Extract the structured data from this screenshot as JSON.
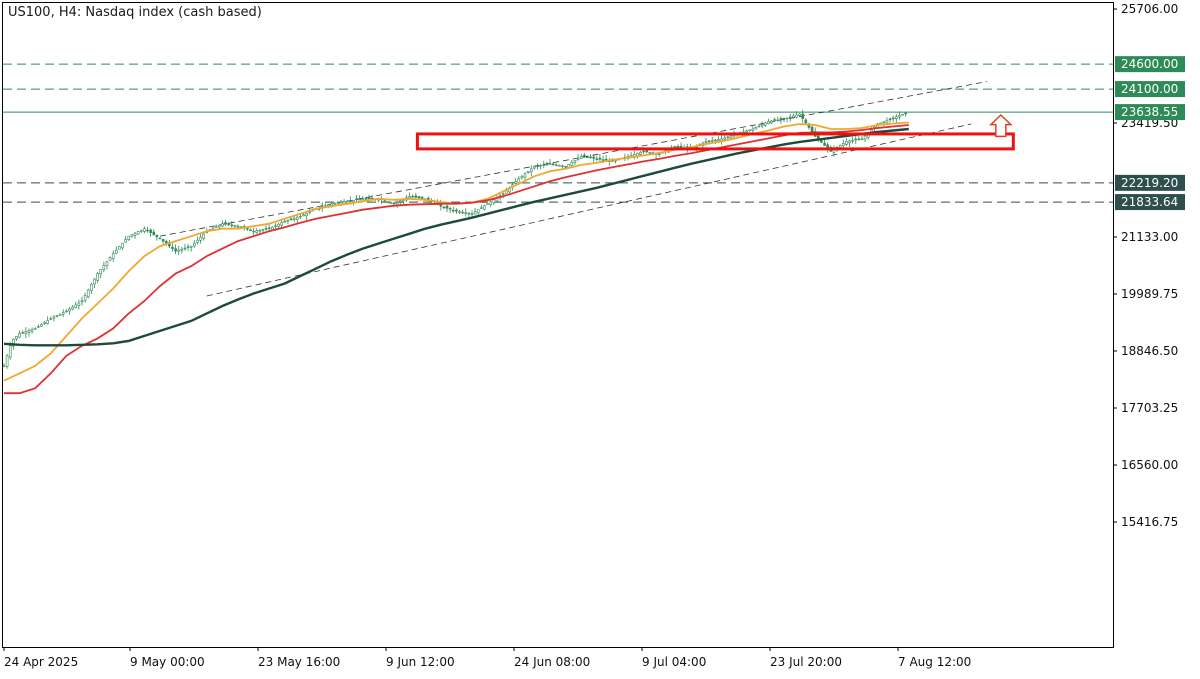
{
  "header": {
    "title": "US100, H4:  Nasdaq index (cash based)"
  },
  "chart_data": {
    "type": "candlestick",
    "title": "US100, H4:  Nasdaq index (cash based)",
    "symbol": "US100",
    "timeframe": "H4",
    "instrument": "Nasdaq index (cash based)",
    "xlabel": "",
    "ylabel": "",
    "ylim": [
      14650,
      25706
    ],
    "x_tick_labels": [
      "24 Apr 2025",
      "9 May 00:00",
      "23 May 16:00",
      "9 Jun 12:00",
      "24 Jun 08:00",
      "9 Jul 04:00",
      "23 Jul 20:00",
      "7 Aug 12:00"
    ],
    "y_tick_labels": [
      {
        "value": 25706.0,
        "label": "25706.00"
      },
      {
        "value": 23419.5,
        "label": "23419.50"
      },
      {
        "value": 21133.0,
        "label": "21133.00"
      },
      {
        "value": 19989.75,
        "label": "19989.75"
      },
      {
        "value": 18846.5,
        "label": "18846.50"
      },
      {
        "value": 17703.25,
        "label": "17703.25"
      },
      {
        "value": 16560.0,
        "label": "16560.00"
      },
      {
        "value": 15416.75,
        "label": "15416.75"
      }
    ],
    "price_levels": [
      {
        "value": 24600.0,
        "label": "24600.00",
        "style": "dashed",
        "color": "#2e8b57"
      },
      {
        "value": 24100.0,
        "label": "24100.00",
        "style": "dashed",
        "color": "#2e8b57"
      },
      {
        "value": 23638.55,
        "label": "23638.55",
        "style": "solid",
        "color": "#2e8b57",
        "current_price": true
      },
      {
        "value": 22219.2,
        "label": "22219.20",
        "style": "dashed",
        "color": "#2f4f4f"
      },
      {
        "value": 21833.64,
        "label": "21833.64",
        "style": "dashed",
        "color": "#2f4f4f"
      }
    ],
    "price_path": [
      [
        0,
        18550
      ],
      [
        0.5,
        19050
      ],
      [
        1,
        19200
      ],
      [
        2,
        19300
      ],
      [
        3,
        19500
      ],
      [
        4,
        19650
      ],
      [
        5,
        19850
      ],
      [
        6,
        20400
      ],
      [
        7,
        20800
      ],
      [
        8,
        21150
      ],
      [
        9,
        21300
      ],
      [
        10,
        21100
      ],
      [
        11,
        20850
      ],
      [
        12,
        20950
      ],
      [
        13,
        21250
      ],
      [
        14,
        21400
      ],
      [
        15,
        21350
      ],
      [
        16,
        21250
      ],
      [
        17,
        21300
      ],
      [
        18,
        21450
      ],
      [
        19,
        21550
      ],
      [
        20,
        21700
      ],
      [
        21,
        21800
      ],
      [
        22,
        21850
      ],
      [
        23,
        21900
      ],
      [
        24,
        21900
      ],
      [
        25,
        21800
      ],
      [
        26,
        21950
      ],
      [
        27,
        21900
      ],
      [
        28,
        21750
      ],
      [
        29,
        21650
      ],
      [
        30,
        21600
      ],
      [
        31,
        21800
      ],
      [
        32,
        22000
      ],
      [
        33,
        22300
      ],
      [
        34,
        22550
      ],
      [
        35,
        22600
      ],
      [
        36,
        22550
      ],
      [
        37,
        22750
      ],
      [
        38,
        22700
      ],
      [
        39,
        22650
      ],
      [
        40,
        22750
      ],
      [
        41,
        22850
      ],
      [
        42,
        22800
      ],
      [
        43,
        22950
      ],
      [
        44,
        22900
      ],
      [
        45,
        23050
      ],
      [
        46,
        23100
      ],
      [
        47,
        23200
      ],
      [
        48,
        23300
      ],
      [
        49,
        23450
      ],
      [
        50,
        23500
      ],
      [
        51,
        23600
      ],
      [
        52,
        23150
      ],
      [
        53,
        22850
      ],
      [
        54,
        23050
      ],
      [
        55,
        23100
      ],
      [
        56,
        23400
      ],
      [
        57,
        23520
      ],
      [
        58,
        23640
      ]
    ],
    "indicators": [
      {
        "name": "MA-fast",
        "color": "#f0a830",
        "values": [
          [
            0,
            18250
          ],
          [
            1,
            18400
          ],
          [
            2,
            18550
          ],
          [
            3,
            18800
          ],
          [
            4,
            19150
          ],
          [
            5,
            19500
          ],
          [
            6,
            19800
          ],
          [
            7,
            20100
          ],
          [
            8,
            20450
          ],
          [
            9,
            20750
          ],
          [
            10,
            20950
          ],
          [
            11,
            21050
          ],
          [
            12,
            21150
          ],
          [
            13,
            21250
          ],
          [
            14,
            21300
          ],
          [
            15,
            21300
          ],
          [
            16,
            21350
          ],
          [
            17,
            21400
          ],
          [
            18,
            21500
          ],
          [
            19,
            21600
          ],
          [
            20,
            21700
          ],
          [
            21,
            21750
          ],
          [
            22,
            21800
          ],
          [
            23,
            21850
          ],
          [
            24,
            21900
          ],
          [
            25,
            21880
          ],
          [
            26,
            21900
          ],
          [
            27,
            21880
          ],
          [
            28,
            21830
          ],
          [
            29,
            21800
          ],
          [
            30,
            21820
          ],
          [
            31,
            21900
          ],
          [
            32,
            22050
          ],
          [
            33,
            22200
          ],
          [
            34,
            22350
          ],
          [
            35,
            22450
          ],
          [
            36,
            22500
          ],
          [
            37,
            22580
          ],
          [
            38,
            22620
          ],
          [
            39,
            22680
          ],
          [
            40,
            22720
          ],
          [
            41,
            22770
          ],
          [
            42,
            22820
          ],
          [
            43,
            22880
          ],
          [
            44,
            22930
          ],
          [
            45,
            23000
          ],
          [
            46,
            23050
          ],
          [
            47,
            23120
          ],
          [
            48,
            23200
          ],
          [
            49,
            23270
          ],
          [
            50,
            23350
          ],
          [
            51,
            23400
          ],
          [
            52,
            23380
          ],
          [
            53,
            23300
          ],
          [
            54,
            23300
          ],
          [
            55,
            23320
          ],
          [
            56,
            23380
          ],
          [
            57,
            23410
          ],
          [
            58,
            23430
          ]
        ]
      },
      {
        "name": "MA-medium",
        "color": "#e03030",
        "values": [
          [
            0,
            18000
          ],
          [
            1,
            18000
          ],
          [
            2,
            18100
          ],
          [
            3,
            18400
          ],
          [
            4,
            18750
          ],
          [
            5,
            18950
          ],
          [
            6,
            19100
          ],
          [
            7,
            19300
          ],
          [
            8,
            19600
          ],
          [
            9,
            19850
          ],
          [
            10,
            20150
          ],
          [
            11,
            20400
          ],
          [
            12,
            20550
          ],
          [
            13,
            20750
          ],
          [
            14,
            20900
          ],
          [
            15,
            21050
          ],
          [
            16,
            21150
          ],
          [
            17,
            21250
          ],
          [
            18,
            21330
          ],
          [
            19,
            21420
          ],
          [
            20,
            21500
          ],
          [
            21,
            21560
          ],
          [
            22,
            21620
          ],
          [
            23,
            21680
          ],
          [
            24,
            21720
          ],
          [
            25,
            21760
          ],
          [
            26,
            21780
          ],
          [
            27,
            21790
          ],
          [
            28,
            21800
          ],
          [
            29,
            21800
          ],
          [
            30,
            21820
          ],
          [
            31,
            21870
          ],
          [
            32,
            21950
          ],
          [
            33,
            22050
          ],
          [
            34,
            22150
          ],
          [
            35,
            22250
          ],
          [
            36,
            22330
          ],
          [
            37,
            22400
          ],
          [
            38,
            22470
          ],
          [
            39,
            22530
          ],
          [
            40,
            22590
          ],
          [
            41,
            22650
          ],
          [
            42,
            22700
          ],
          [
            43,
            22760
          ],
          [
            44,
            22810
          ],
          [
            45,
            22870
          ],
          [
            46,
            22930
          ],
          [
            47,
            22990
          ],
          [
            48,
            23050
          ],
          [
            49,
            23110
          ],
          [
            50,
            23170
          ],
          [
            51,
            23220
          ],
          [
            52,
            23230
          ],
          [
            53,
            23230
          ],
          [
            54,
            23250
          ],
          [
            55,
            23280
          ],
          [
            56,
            23320
          ],
          [
            57,
            23350
          ],
          [
            58,
            23380
          ]
        ]
      },
      {
        "name": "MA-slow",
        "color": "#1e4a3a",
        "values": [
          [
            0,
            18990
          ],
          [
            1,
            18970
          ],
          [
            2,
            18960
          ],
          [
            3,
            18960
          ],
          [
            4,
            18960
          ],
          [
            5,
            18970
          ],
          [
            6,
            18980
          ],
          [
            7,
            19000
          ],
          [
            8,
            19050
          ],
          [
            9,
            19150
          ],
          [
            10,
            19250
          ],
          [
            11,
            19350
          ],
          [
            12,
            19450
          ],
          [
            13,
            19600
          ],
          [
            14,
            19750
          ],
          [
            15,
            19880
          ],
          [
            16,
            20000
          ],
          [
            17,
            20100
          ],
          [
            18,
            20200
          ],
          [
            19,
            20350
          ],
          [
            20,
            20500
          ],
          [
            21,
            20650
          ],
          [
            22,
            20780
          ],
          [
            23,
            20900
          ],
          [
            24,
            21000
          ],
          [
            25,
            21100
          ],
          [
            26,
            21200
          ],
          [
            27,
            21300
          ],
          [
            28,
            21380
          ],
          [
            29,
            21450
          ],
          [
            30,
            21520
          ],
          [
            31,
            21600
          ],
          [
            32,
            21680
          ],
          [
            33,
            21760
          ],
          [
            34,
            21840
          ],
          [
            35,
            21910
          ],
          [
            36,
            21980
          ],
          [
            37,
            22050
          ],
          [
            38,
            22120
          ],
          [
            39,
            22200
          ],
          [
            40,
            22280
          ],
          [
            41,
            22360
          ],
          [
            42,
            22440
          ],
          [
            43,
            22520
          ],
          [
            44,
            22600
          ],
          [
            45,
            22670
          ],
          [
            46,
            22740
          ],
          [
            47,
            22810
          ],
          [
            48,
            22870
          ],
          [
            49,
            22930
          ],
          [
            50,
            22990
          ],
          [
            51,
            23040
          ],
          [
            52,
            23080
          ],
          [
            53,
            23120
          ],
          [
            54,
            23160
          ],
          [
            55,
            23200
          ],
          [
            56,
            23240
          ],
          [
            57,
            23270
          ],
          [
            58,
            23300
          ]
        ]
      }
    ],
    "channel_lines": [
      {
        "name": "upper-channel",
        "from": [
          10,
          21150
        ],
        "to": [
          63,
          24250
        ]
      },
      {
        "name": "lower-channel",
        "from": [
          13,
          19950
        ],
        "to": [
          62,
          23400
        ]
      }
    ],
    "annotations": [
      {
        "type": "rectangle",
        "name": "support-zone",
        "x_from": 26.5,
        "x_to": 64.7,
        "y_low": 22900,
        "y_high": 23200,
        "color": "#ee1111"
      },
      {
        "type": "arrow-up",
        "name": "up-arrow",
        "x": 63.9,
        "y_low": 23150,
        "y_high": 23580,
        "color": "#e04020"
      }
    ],
    "grid": false,
    "colors": {
      "bull_candle": "#2e8b57",
      "bear_candle": "#2e8b57",
      "current_price_label": "#2e8b57",
      "level_label": "#2f4f4f"
    }
  }
}
